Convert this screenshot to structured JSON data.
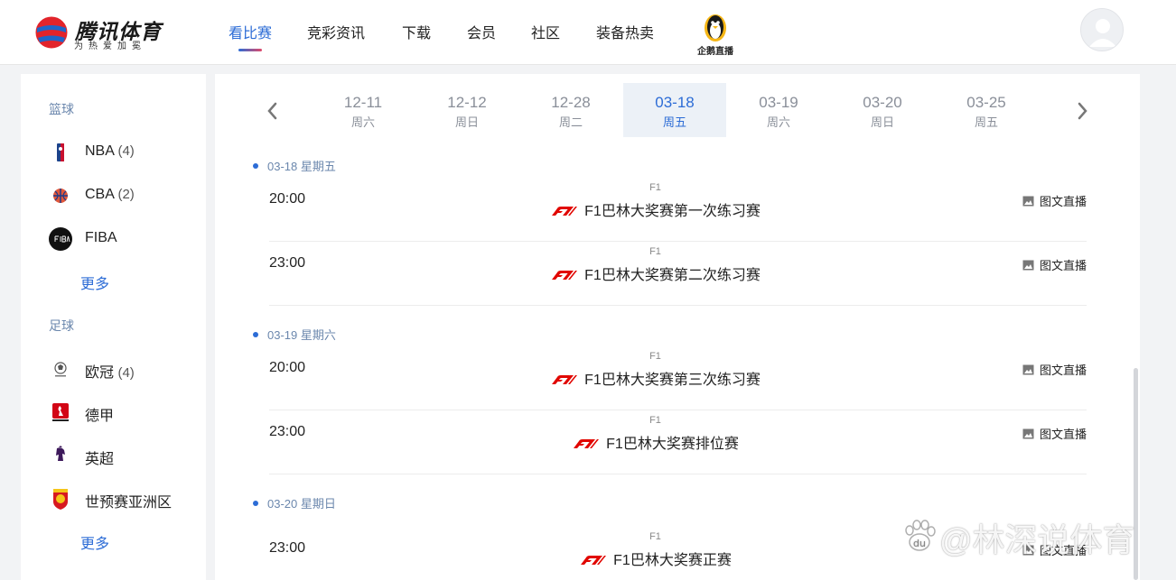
{
  "header": {
    "logo_title": "腾讯体育",
    "logo_slogan": "为热爱加冕",
    "nav": [
      "看比赛",
      "竞彩资讯",
      "下载",
      "会员",
      "社区",
      "装备热卖"
    ],
    "penguin_label": "企鹅直播"
  },
  "sidebar": {
    "basketball": {
      "title": "篮球",
      "items": [
        {
          "label": "NBA",
          "count": "(4)",
          "icon": "nba-icon"
        },
        {
          "label": "CBA",
          "count": "(2)",
          "icon": "cba-icon"
        },
        {
          "label": "FIBA",
          "count": "",
          "icon": "fiba-icon"
        }
      ],
      "more": "更多"
    },
    "football": {
      "title": "足球",
      "items": [
        {
          "label": "欧冠",
          "count": "(4)",
          "icon": "champions-league-icon"
        },
        {
          "label": "德甲",
          "count": "",
          "icon": "bundesliga-icon"
        },
        {
          "label": "英超",
          "count": "",
          "icon": "premier-league-icon"
        },
        {
          "label": "世预赛亚洲区",
          "count": "",
          "icon": "china-football-icon"
        }
      ],
      "more": "更多"
    }
  },
  "dates": [
    {
      "date": "12-11",
      "weekday": "周六"
    },
    {
      "date": "12-12",
      "weekday": "周日"
    },
    {
      "date": "12-28",
      "weekday": "周二"
    },
    {
      "date": "03-18",
      "weekday": "周五",
      "active": true
    },
    {
      "date": "03-19",
      "weekday": "周六"
    },
    {
      "date": "03-20",
      "weekday": "周日"
    },
    {
      "date": "03-25",
      "weekday": "周五"
    }
  ],
  "schedule": [
    {
      "day": "03-18 星期五",
      "matches": [
        {
          "time": "20:00",
          "category": "F1",
          "title": "F1巴林大奖赛第一次练习赛",
          "live": "图文直播"
        },
        {
          "time": "23:00",
          "category": "F1",
          "title": "F1巴林大奖赛第二次练习赛",
          "live": "图文直播"
        }
      ]
    },
    {
      "day": "03-19 星期六",
      "matches": [
        {
          "time": "20:00",
          "category": "F1",
          "title": "F1巴林大奖赛第三次练习赛",
          "live": "图文直播"
        },
        {
          "time": "23:00",
          "category": "F1",
          "title": "F1巴林大奖赛排位赛",
          "live": "图文直播"
        }
      ]
    },
    {
      "day": "03-20 星期日",
      "matches": [
        {
          "time": "23:00",
          "category": "F1",
          "title": "F1巴林大奖赛正赛",
          "live": "图文直播"
        }
      ]
    }
  ],
  "watermark": "@林深说体育",
  "colors": {
    "accent": "#2c6cd6",
    "f1_red": "#e10600",
    "group_title": "#6b87ad"
  }
}
